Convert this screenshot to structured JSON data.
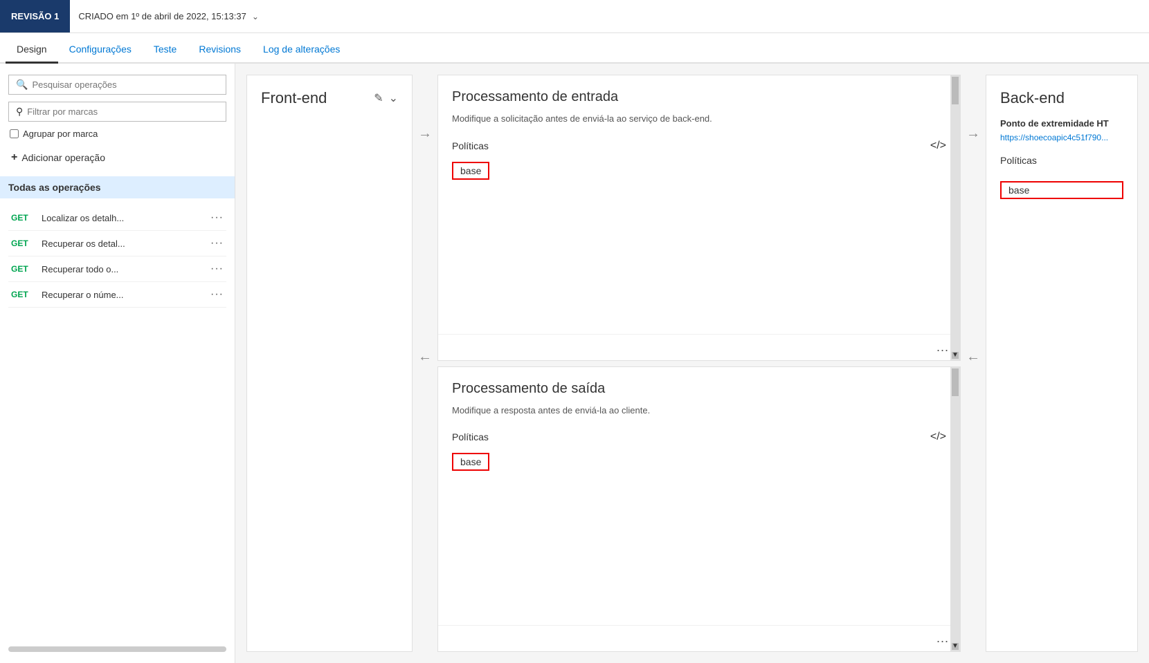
{
  "topbar": {
    "revision_badge": "REVISÃO 1",
    "revision_info": "CRIADO em 1º de abril de 2022, 15:13:37",
    "chevron": "⌄"
  },
  "tabs": [
    {
      "id": "design",
      "label": "Design",
      "active": true
    },
    {
      "id": "configuracoes",
      "label": "Configurações",
      "active": false
    },
    {
      "id": "teste",
      "label": "Teste",
      "active": false
    },
    {
      "id": "revisions",
      "label": "Revisions",
      "active": false
    },
    {
      "id": "log",
      "label": "Log de alterações",
      "active": false
    }
  ],
  "sidebar": {
    "search_placeholder": "Pesquisar operações",
    "filter_placeholder": "Filtrar por marcas",
    "group_label": "Agrupar por marca",
    "add_operation": "Adicionar operação",
    "all_operations": "Todas as operações",
    "operations": [
      {
        "method": "GET",
        "name": "Localizar os detalh..."
      },
      {
        "method": "GET",
        "name": "Recuperar os detal..."
      },
      {
        "method": "GET",
        "name": "Recuperar todo o..."
      },
      {
        "method": "GET",
        "name": "Recuperar o núme..."
      }
    ]
  },
  "frontend": {
    "title": "Front-end",
    "edit_icon": "✎",
    "chevron_icon": "⌄"
  },
  "arrows": {
    "right": "→",
    "left": "←"
  },
  "processing_input": {
    "title": "Processamento de entrada",
    "description": "Modifique a solicitação antes de enviá-la ao serviço de back-end.",
    "policies_label": "Políticas",
    "code_icon": "</>",
    "base_tag": "base",
    "dots": "..."
  },
  "processing_output": {
    "title": "Processamento de saída",
    "description": "Modifique a resposta antes de enviá-la ao cliente.",
    "policies_label": "Políticas",
    "code_icon": "</>",
    "base_tag": "base",
    "dots": "..."
  },
  "backend": {
    "title": "Back-end",
    "endpoint_label": "Ponto de extremidade HT",
    "url": "https://shoecoapic4c51f790...",
    "policies_label": "Políticas",
    "base_tag": "base"
  }
}
